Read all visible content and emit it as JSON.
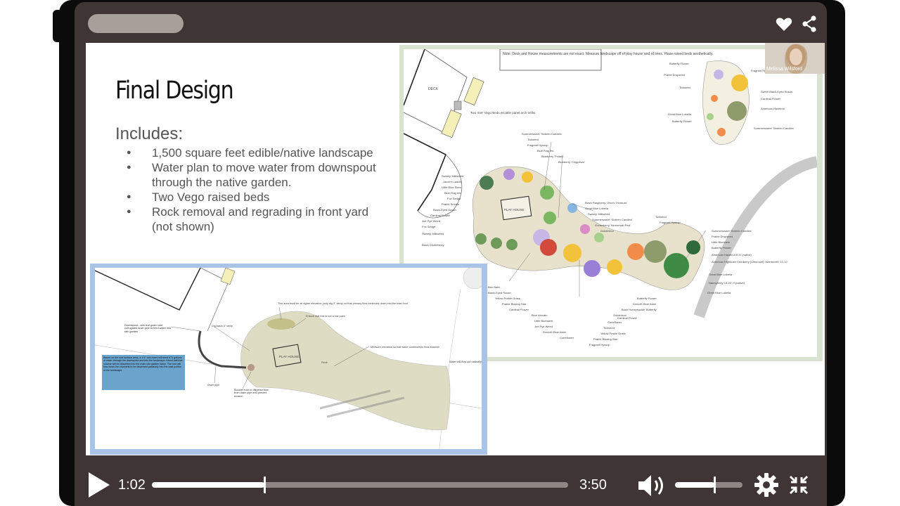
{
  "player": {
    "current_time": "1:02",
    "duration": "3:50",
    "progress": 0.27,
    "volume": 0.58
  },
  "slide": {
    "title": "Final Design",
    "includes": "Includes:",
    "bullets": [
      "1,500 square feet edible/native landscape",
      "Water plan to move water from downspout through the native garden.",
      "Two Vego raised beds",
      "Rock removal and regrading in front yard (not shown)"
    ]
  },
  "webcam": {
    "name": "Melissa Wilsford"
  },
  "plan": {
    "note": "Note: Deck and House measurements are not exact. Measure landscape off of play house and rd lines. Place raised beds aesthetically.",
    "deck": "DECK",
    "vego_beds": "Two 4'x8' Vego Beds w/cattle panel arch trellis",
    "playhouse": "PLAY HOUSE"
  },
  "drain": {
    "playhouse": "PLAY HOUSE",
    "note_box": "Based on the roof surface area, a 1.5\" rain event will send 671 gallons of water through the downspout and into the landscape. About half that volume will be absorbed into the main rain garden basin. The rest will flow down the channels to be dispersed passively into the east portion of the landscape.",
    "labels": {
      "downspout": "Downspout - add leaf guard and corrugated drain pipe to feed water into rain garden",
      "dig_basin": "Dig basin 4\" deep",
      "higher_elev": "This area must be at higher elevation (only dig 3\" deep) so that primary flow continues down into the main bod",
      "low_point": "Ensure that this is not a low point",
      "measure": "Measure elevation so that water continues to flow downhill",
      "drain_pipe": "Drain pipe",
      "boulder": "Boulder rock to disperse flow from drain pipe and prevent erosion",
      "water_flow": "Water will flow out naturally",
      "rock_marks": "Rock"
    }
  },
  "plants": {
    "left": [
      "Summersweet 'Sixteen Candles'",
      "Tickseed",
      "Fragrant Hyssop",
      "Blue Flag Iris",
      "Blueberry 'Polaris'",
      "Blueberry 'Chippewa'",
      "Swamp Milkweed",
      "Jacob's Ladder",
      "Little Blue Stem",
      "Blue Flag Iris",
      "Fox Sedge",
      "Prairie Smoke",
      "Black-Eyed Susan",
      "Cardinal Flower",
      "Joe Pye Weed",
      "Fox Sedge",
      "Swamp Milkweed",
      "Black Chokeberry"
    ],
    "bottom": [
      "Bee Balm",
      "Black-Eyed Susan",
      "Yellow Prairie Grass",
      "Prairie Blazing Star",
      "Cardinal Flower",
      "Blue Vervain",
      "Little Bluestem",
      "Joe Pye Weed",
      "Smooth Blue Aster",
      "Coneflower",
      "Coneflower",
      "Tickseed",
      "Yellow Prairie Grass",
      "Prairie Blazing Star",
      "Fragrant Hyssop"
    ],
    "middle": [
      "Black Raspberry 'Ohio's Treasure'",
      "Great Blue Lobelia",
      "Swamp Milkweed",
      "Summersweet 'Sixteen Candles'",
      "Gooseberry 'Hinnomaki Red'",
      "Goldenrod"
    ],
    "right": [
      "Tickseed",
      "Fragrant Hyssop",
      "Summersweet 'Sixteen Candles'",
      "Prairie Dropseed",
      "Little Bluestem",
      "Butterfly Flower",
      "American Hazelnut 6'-8' (native)",
      "American Highbush Cranberry (Viburnum) 'Wentworth' 10-12'",
      "Great Blue Lobelia",
      "Nannyberry 15-20' H (native)",
      "Great Blue Lobelia",
      "Butterfly Flower",
      "Smooth Blue Aster",
      "Bush Honeysuckle 'Butterfly'",
      "Goldenrod",
      "Cardinal Flower"
    ],
    "corner": [
      "Butterfly Flower",
      "Prairie Dropseed",
      "Tickseed",
      "Great Blue Lobelia",
      "Butterfly Flower",
      "Fragrant Hyssop",
      "Sweet Black-Eyed Susan",
      "Cardinal Flower",
      "American Hazelnut",
      "Summersweet 'Sixteen Candles'"
    ]
  }
}
